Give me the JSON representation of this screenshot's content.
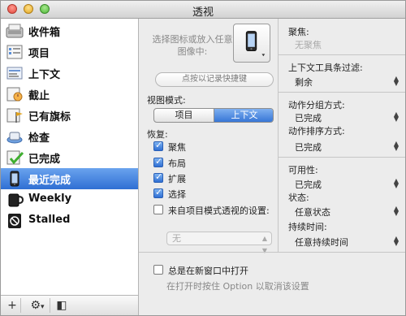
{
  "window": {
    "title": "透视"
  },
  "sidebar": {
    "items": [
      {
        "label": "收件箱",
        "icon": "inbox-icon"
      },
      {
        "label": "项目",
        "icon": "projects-icon"
      },
      {
        "label": "上下文",
        "icon": "contexts-icon"
      },
      {
        "label": "截止",
        "icon": "due-icon"
      },
      {
        "label": "已有旗标",
        "icon": "flag-icon"
      },
      {
        "label": "检查",
        "icon": "review-icon"
      },
      {
        "label": "已完成",
        "icon": "completed-icon"
      },
      {
        "label": "最近完成",
        "icon": "phone-icon",
        "selected": true
      },
      {
        "label": "Weekly",
        "icon": "mug-icon"
      },
      {
        "label": "Stalled",
        "icon": "stop-icon"
      }
    ]
  },
  "bottombar": {
    "add": "+",
    "gear": "⚙",
    "menu_arrow": "▾",
    "sidebar_toggle": "◧"
  },
  "middle": {
    "hint": "选择图标或放入任意图像中:",
    "shortcut_label": "点按以记录快捷键",
    "view_mode_label": "视图模式:",
    "segments": [
      "项目",
      "上下文"
    ],
    "selected_segment": 1,
    "restore_label": "恢复:",
    "restore_items": [
      {
        "label": "聚焦",
        "checked": true
      },
      {
        "label": "布局",
        "checked": true
      },
      {
        "label": "扩展",
        "checked": true
      },
      {
        "label": "选择",
        "checked": true
      },
      {
        "label": "来自项目模式透视的设置:",
        "checked": false
      }
    ],
    "project_mode_value": "无"
  },
  "bottom": {
    "open_new_window": "总是在新窗口中打开",
    "open_new_window_checked": false,
    "note": "在打开时按住 Option 以取消该设置"
  },
  "right": {
    "focus_label": "聚焦:",
    "focus_value": "无聚焦",
    "context_filter_label": "上下文工具条过滤:",
    "context_filter_value": "剩余",
    "action_group_label": "动作分组方式:",
    "action_group_value": "已完成",
    "action_sort_label": "动作排序方式:",
    "action_sort_value": "已完成",
    "availability_label": "可用性:",
    "availability_value": "已完成",
    "status_label": "状态:",
    "status_value": "任意状态",
    "duration_label": "持续时间:",
    "duration_value": "任意持续时间"
  },
  "colors": {
    "selection": "#2f6fd3",
    "accent_green": "#3fae2f"
  }
}
